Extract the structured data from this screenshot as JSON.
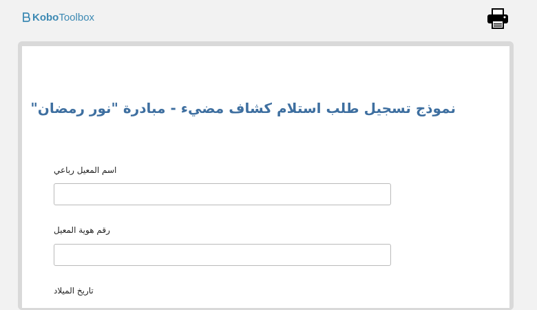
{
  "app": {
    "logo_bold": "Kobo",
    "logo_light": "Toolbox",
    "print_icon": "printer-icon"
  },
  "form": {
    "title": "نموذج تسجيل طلب استلام كشاف مضيء - مبادرة \"نور رمضان\"",
    "questions": [
      {
        "label": "اسم المعيل رباعي",
        "value": ""
      },
      {
        "label": "رقم هوية المعيل",
        "value": ""
      },
      {
        "label": "تاريخ الميلاد",
        "value": ""
      }
    ]
  },
  "colors": {
    "brand": "#3c89b3",
    "title": "#3e6fa0",
    "background": "#f2f2f2"
  }
}
